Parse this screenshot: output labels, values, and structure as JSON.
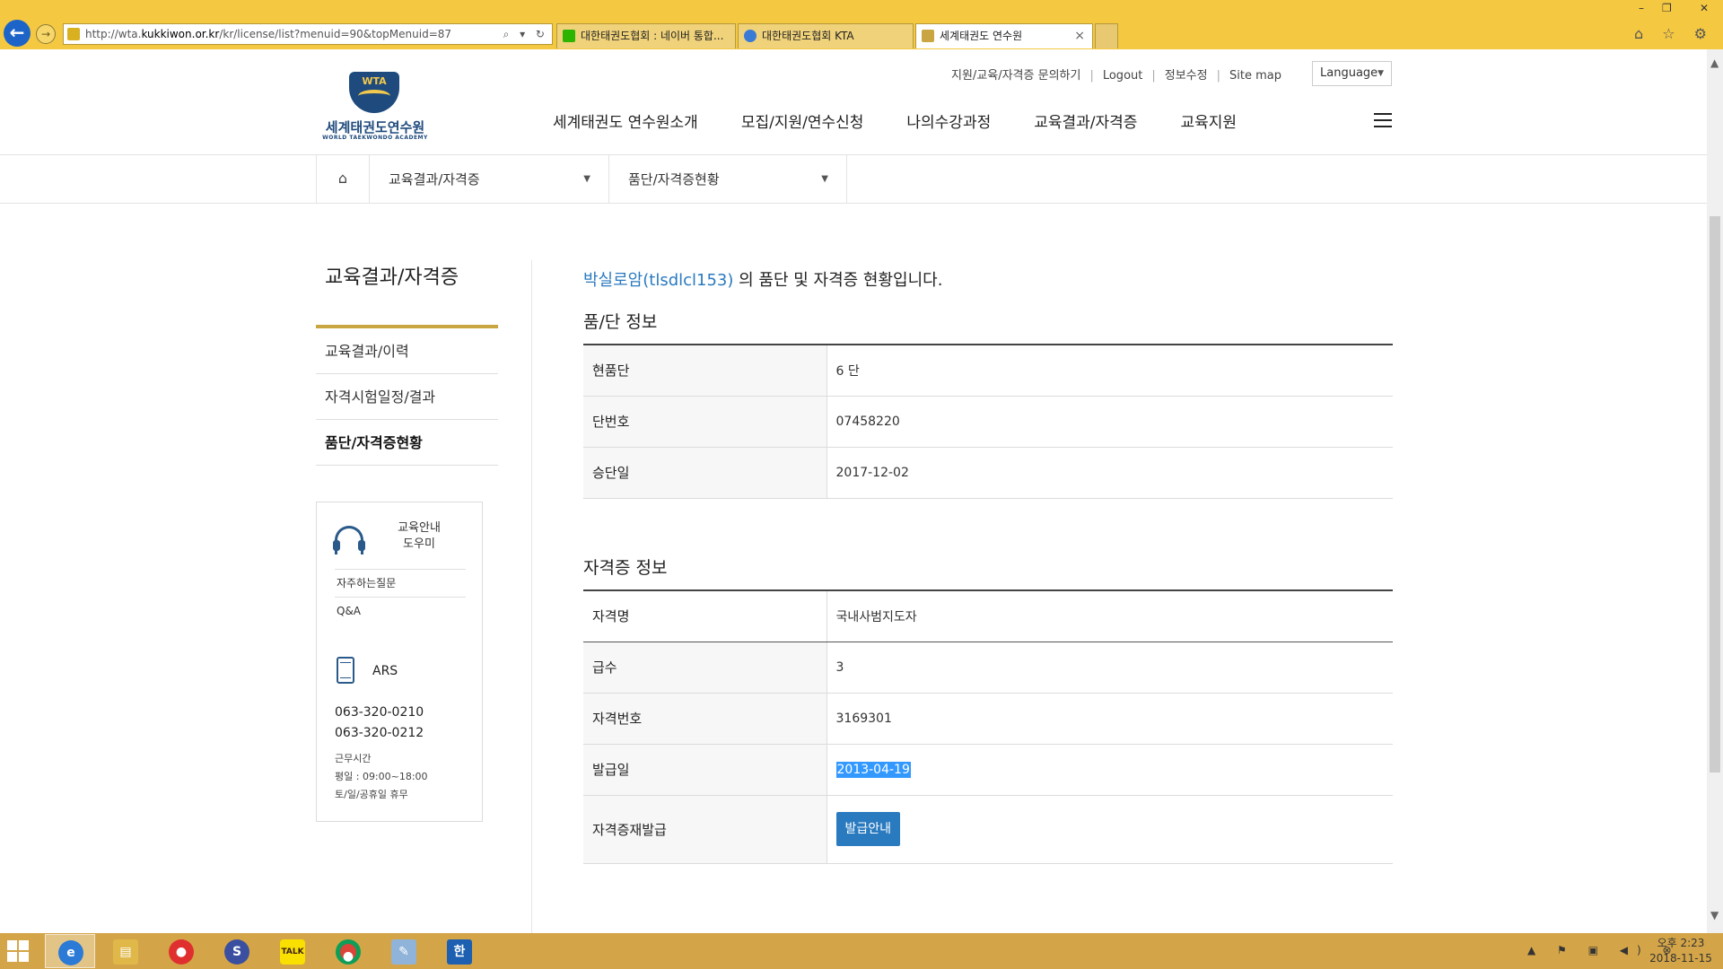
{
  "browser": {
    "url_prefix": "http://wta.",
    "url_domain": "kukkiwon.or.kr",
    "url_path": "/kr/license/list?menuid=90&topMenuid=87",
    "tabs": [
      {
        "label": "대한태권도협회 : 네이버 통합...",
        "icon_color": "#2db400"
      },
      {
        "label": "대한태권도협회 KTA",
        "icon_color": "#3a7bd5"
      },
      {
        "label": "세계태권도 연수원",
        "icon_color": "#c9a642"
      }
    ],
    "address_tools": "⌕ ▾ ↻",
    "window_controls": [
      "–",
      "❐",
      "✕"
    ],
    "toolbar_icons": "⌂ ☆ ⚙"
  },
  "header": {
    "logo_emblem_text": "WTA",
    "logo_ko": "세계태권도연수원",
    "logo_en": "WORLD TAEKWONDO ACADEMY",
    "util_nav": [
      "지원/교육/자격증 문의하기",
      "Logout",
      "정보수정",
      "Site map"
    ],
    "language_label": "Language",
    "gnb": [
      "세계태권도 연수원소개",
      "모집/지원/연수신청",
      "나의수강과정",
      "교육결과/자격증",
      "교육지원"
    ]
  },
  "breadcrumb": {
    "home_icon": "⌂",
    "level1": "교육결과/자격증",
    "level2": "품단/자격증현황"
  },
  "sidebar": {
    "title": "교육결과/자격증",
    "items": [
      "교육결과/이력",
      "자격시험일정/결과",
      "품단/자격증현황"
    ],
    "active_index": 2
  },
  "help": {
    "title_line1": "교육안내",
    "title_line2": "도우미",
    "links": [
      "자주하는질문",
      "Q&A"
    ],
    "ars_label": "ARS",
    "phones": [
      "063-320-0210",
      "063-320-0212"
    ],
    "hours_label": "근무시간",
    "hours_weekday": "평일 : 09:00~18:00",
    "hours_weekend": "토/일/공휴일 휴무"
  },
  "content": {
    "user": "박실로암(tlsdlcl153)",
    "intro_suffix": " 의 품단 및 자격증 현황입니다.",
    "rank_section_title": "품/단 정보",
    "rank": [
      {
        "label": "현품단",
        "value": "6 단"
      },
      {
        "label": "단번호",
        "value": "07458220"
      },
      {
        "label": "승단일",
        "value": "2017-12-02"
      }
    ],
    "license_section_title": "자격증 정보",
    "license_name_label": "자격명",
    "license_name_value": "국내사범지도자",
    "license": [
      {
        "label": "급수",
        "value": "3"
      },
      {
        "label": "자격번호",
        "value": "3169301"
      },
      {
        "label": "발급일",
        "value": "2013-04-19"
      }
    ],
    "reissue_label": "자격증재발급",
    "reissue_button": "발급안내"
  },
  "taskbar": {
    "clock_line1": "오후 2:23",
    "clock_line2": "2018-11-15",
    "tray_icons": "▲ ⚑ ▣ ◀) ⊗"
  }
}
